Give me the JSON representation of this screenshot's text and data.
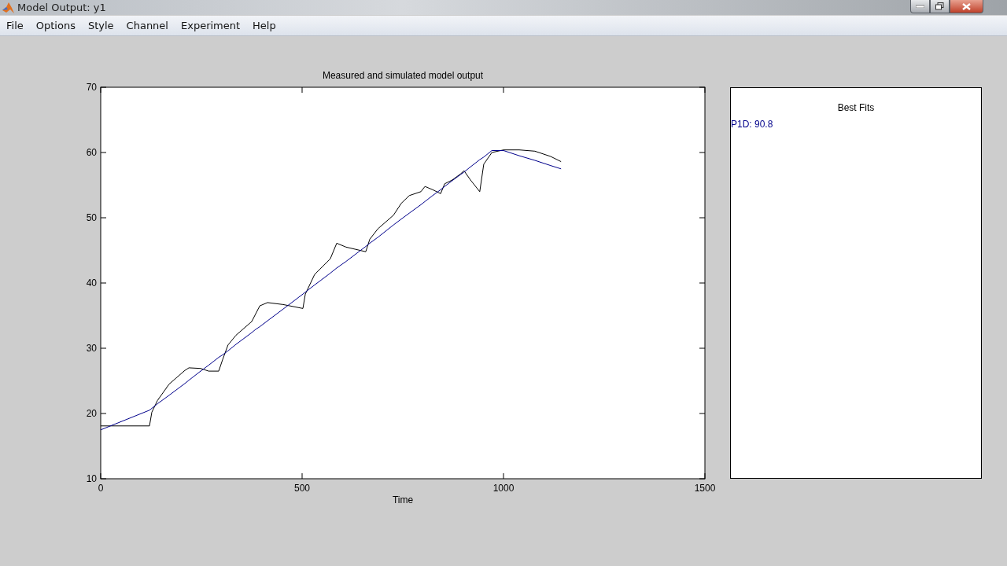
{
  "window": {
    "title": "Model Output: y1"
  },
  "menu": [
    "File",
    "Options",
    "Style",
    "Channel",
    "Experiment",
    "Help"
  ],
  "plot": {
    "chart_data": {
      "type": "line",
      "title": "Measured and simulated model output",
      "xlabel": "Time",
      "xlim": [
        0,
        1500
      ],
      "ylim": [
        10,
        70
      ],
      "xticks": [
        0,
        500,
        1000,
        1500
      ],
      "yticks": [
        10,
        20,
        30,
        40,
        50,
        60,
        70
      ],
      "x": [
        0,
        121,
        127,
        141,
        170,
        209,
        219,
        248,
        268,
        293,
        303,
        316,
        336,
        375,
        385,
        395,
        414,
        453,
        502,
        508,
        531,
        570,
        586,
        609,
        658,
        668,
        688,
        727,
        746,
        766,
        795,
        805,
        824,
        844,
        854,
        873,
        893,
        902,
        918,
        941,
        951,
        971,
        1000,
        1039,
        1078,
        1117,
        1143
      ],
      "series": [
        {
          "color": "#000000",
          "values": [
            18.1,
            18.1,
            20.2,
            22.0,
            24.5,
            26.6,
            27.0,
            26.9,
            26.5,
            26.5,
            28.3,
            30.5,
            32.0,
            34.1,
            35.3,
            36.5,
            37.0,
            36.7,
            36.1,
            38.3,
            41.3,
            43.7,
            46.1,
            45.5,
            44.8,
            46.7,
            48.3,
            50.4,
            52.2,
            53.4,
            54.0,
            54.8,
            54.3,
            53.7,
            55.2,
            55.8,
            56.7,
            57.2,
            55.8,
            54.0,
            58.2,
            60.0,
            60.4,
            60.4,
            60.2,
            59.4,
            58.6
          ]
        },
        {
          "color": "#00008b",
          "values": [
            17.5,
            20.5,
            20.8,
            21.5,
            22.8,
            24.6,
            25.1,
            26.5,
            27.4,
            28.6,
            29.0,
            29.6,
            30.6,
            32.4,
            32.9,
            33.3,
            34.2,
            36.0,
            38.3,
            38.6,
            39.7,
            41.5,
            42.3,
            43.3,
            45.6,
            46.1,
            47.0,
            48.9,
            49.8,
            50.7,
            52.0,
            52.5,
            53.4,
            54.3,
            54.8,
            55.7,
            56.6,
            57.0,
            57.8,
            58.9,
            59.3,
            60.3,
            60.3,
            59.5,
            58.8,
            58.0,
            57.5
          ]
        }
      ]
    }
  },
  "best_fits": {
    "title": "Best Fits",
    "entries": [
      {
        "label": "P1D: 90.8",
        "color": "#00008b"
      }
    ]
  }
}
